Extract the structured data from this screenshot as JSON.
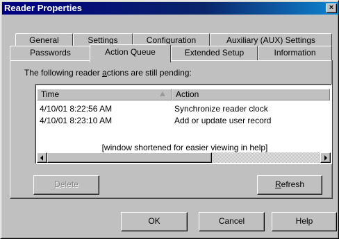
{
  "window": {
    "title": "Reader Properties",
    "close_label": "×"
  },
  "tabs": {
    "row1": [
      {
        "label": "General"
      },
      {
        "label": "Settings"
      },
      {
        "label": "Configuration"
      },
      {
        "label": "Auxiliary (AUX) Settings"
      }
    ],
    "row2": [
      {
        "label": "Passwords"
      },
      {
        "label": "Action Queue",
        "active": true
      },
      {
        "label": "Extended Setup"
      },
      {
        "label": "Information"
      }
    ]
  },
  "action_queue": {
    "label_prefix": "The following reader ",
    "label_mnemonic": "a",
    "label_suffix": "ctions are still pending:",
    "columns": {
      "time": "Time",
      "action": "Action"
    },
    "rows": [
      {
        "time": "4/10/01 8:22:56 AM",
        "action": "Synchronize reader clock"
      },
      {
        "time": "4/10/01 8:23:10 AM",
        "action": "Add or update user record"
      }
    ],
    "note": "[window shortened for easier viewing in help]",
    "delete_mnemonic": "D",
    "delete_rest": "elete",
    "refresh_mnemonic": "R",
    "refresh_rest": "efresh"
  },
  "footer": {
    "ok_label": "OK",
    "cancel_label": "Cancel",
    "help_label": "Help"
  },
  "colors": {
    "face": "#c0c0c0",
    "titlebar": "#000080",
    "disabled_text": "#808080"
  }
}
